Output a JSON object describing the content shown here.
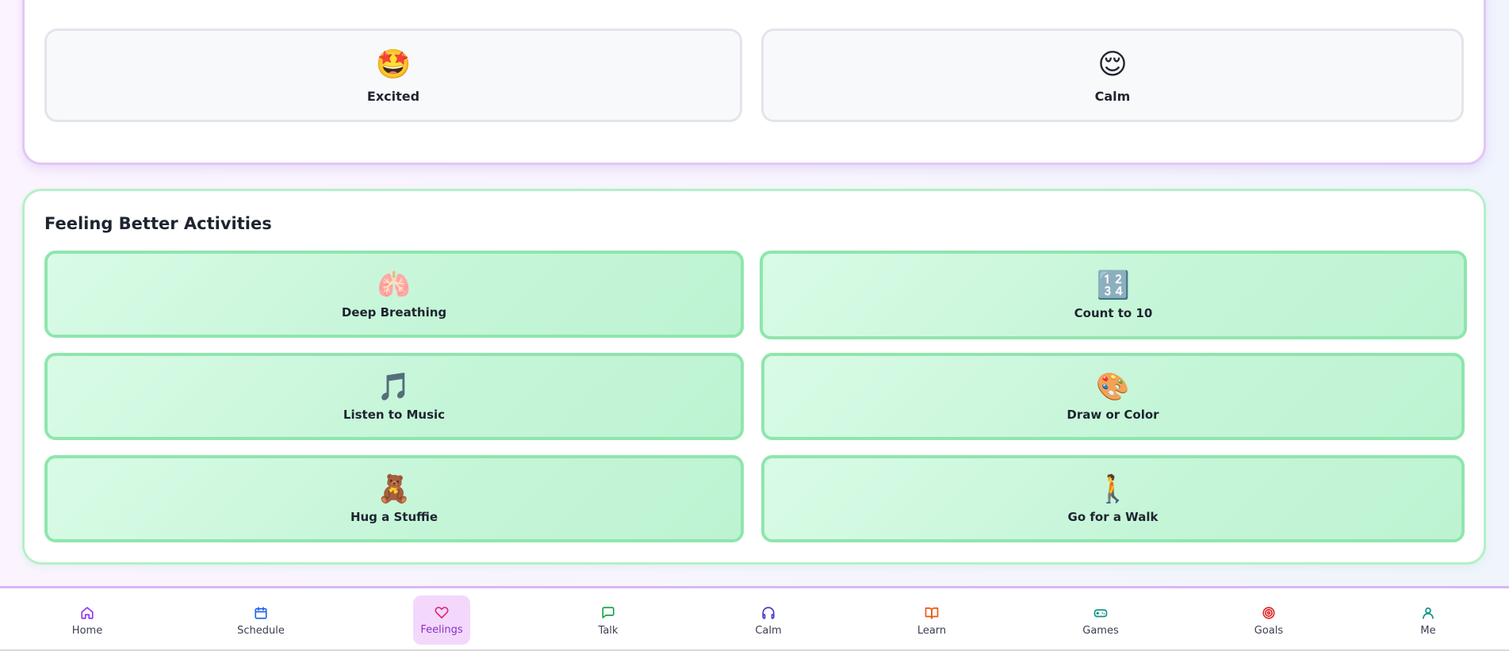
{
  "feelings": {
    "tiles": [
      {
        "label": "Excited",
        "emoji": "🤩",
        "icon": "star-struck-icon"
      },
      {
        "label": "Calm",
        "emoji": "😌",
        "icon": "relieved-face-icon"
      }
    ]
  },
  "activities": {
    "title": "Feeling Better Activities",
    "tiles": [
      {
        "label": "Deep Breathing",
        "emoji": "🫁",
        "icon": "lungs-icon"
      },
      {
        "label": "Count to 10",
        "emoji": "🔢",
        "icon": "numbers-icon"
      },
      {
        "label": "Listen to Music",
        "emoji": "🎵",
        "icon": "music-note-icon"
      },
      {
        "label": "Draw or Color",
        "emoji": "🎨",
        "icon": "palette-icon"
      },
      {
        "label": "Hug a Stuffie",
        "emoji": "🧸",
        "icon": "teddy-bear-icon"
      },
      {
        "label": "Go for a Walk",
        "emoji": "🚶",
        "icon": "walking-person-icon"
      }
    ]
  },
  "nav": {
    "active": "Feelings",
    "items": [
      {
        "label": "Home",
        "icon": "home-icon",
        "color": "#9333ea"
      },
      {
        "label": "Schedule",
        "icon": "calendar-icon",
        "color": "#2563eb"
      },
      {
        "label": "Feelings",
        "icon": "heart-icon",
        "color": "#db2777"
      },
      {
        "label": "Talk",
        "icon": "chat-icon",
        "color": "#16a34a"
      },
      {
        "label": "Calm",
        "icon": "headphones-icon",
        "color": "#4338ca"
      },
      {
        "label": "Learn",
        "icon": "book-icon",
        "color": "#ea580c"
      },
      {
        "label": "Games",
        "icon": "gamepad-icon",
        "color": "#0d9488"
      },
      {
        "label": "Goals",
        "icon": "target-icon",
        "color": "#dc2626"
      },
      {
        "label": "Me",
        "icon": "user-icon",
        "color": "#0d9488"
      }
    ]
  }
}
